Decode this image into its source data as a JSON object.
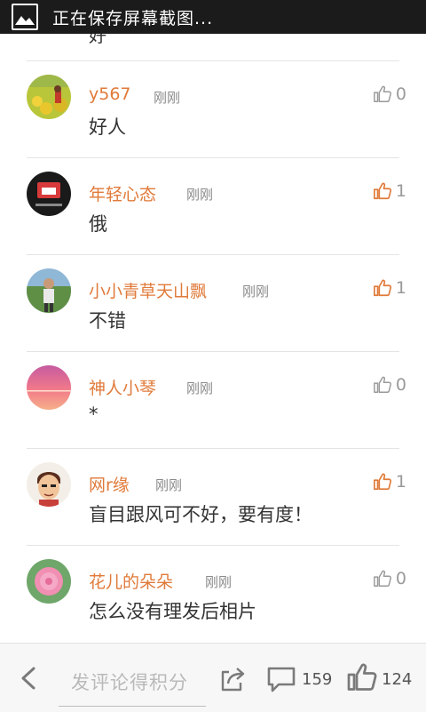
{
  "status_bar": {
    "title": "正在保存屏幕截图..."
  },
  "partial_comment_text": "好",
  "comments": [
    {
      "name": "y567",
      "time": "刚刚",
      "likes": "0",
      "liked": false,
      "text": "好人"
    },
    {
      "name": "年轻心态",
      "time": "刚刚",
      "likes": "1",
      "liked": true,
      "text": "俄"
    },
    {
      "name": "小小青草天山飘",
      "time": "刚刚",
      "likes": "1",
      "liked": true,
      "text": "不错"
    },
    {
      "name": "神人小琴",
      "time": "刚刚",
      "likes": "0",
      "liked": false,
      "text": "*"
    },
    {
      "name": "网r缘",
      "time": "刚刚",
      "likes": "1",
      "liked": true,
      "text": "盲目跟风可不好，要有度！"
    },
    {
      "name": "花儿的朵朵",
      "time": "刚刚",
      "likes": "0",
      "liked": false,
      "text": "怎么没有理发后相片"
    }
  ],
  "bottom_bar": {
    "input_placeholder": "发评论得积分",
    "comment_count": "159",
    "like_count": "124"
  },
  "colors": {
    "accent": "#e07a3a",
    "muted": "#9a9a9a",
    "text": "#333333"
  }
}
